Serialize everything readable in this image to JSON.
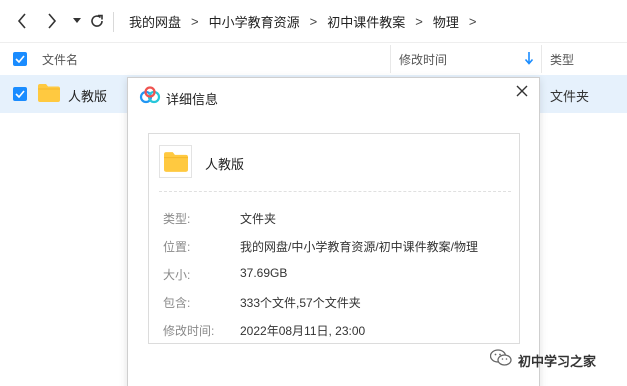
{
  "breadcrumb": [
    "我的网盘",
    "中小学教育资源",
    "初中课件教案",
    "物理"
  ],
  "breadcrumb_separator": ">",
  "columns": {
    "name": "文件名",
    "modified": "修改时间",
    "type": "类型"
  },
  "row": {
    "name": "人教版",
    "type": "文件夹"
  },
  "dialog": {
    "title": "详细信息",
    "item_name": "人教版",
    "props": [
      {
        "label": "类型:",
        "value": "文件夹"
      },
      {
        "label": "位置:",
        "value": "我的网盘/中小学教育资源/初中课件教案/物理"
      },
      {
        "label": "大小:",
        "value": "37.69GB"
      },
      {
        "label": "包含:",
        "value": "333个文件,57个文件夹"
      },
      {
        "label": "修改时间:",
        "value": "2022年08月11日, 23:00"
      }
    ]
  },
  "watermark": "初中学习之家",
  "colors": {
    "accent": "#1a8cff",
    "selected_row": "#e6f1fc",
    "folder": "#ffc940"
  }
}
